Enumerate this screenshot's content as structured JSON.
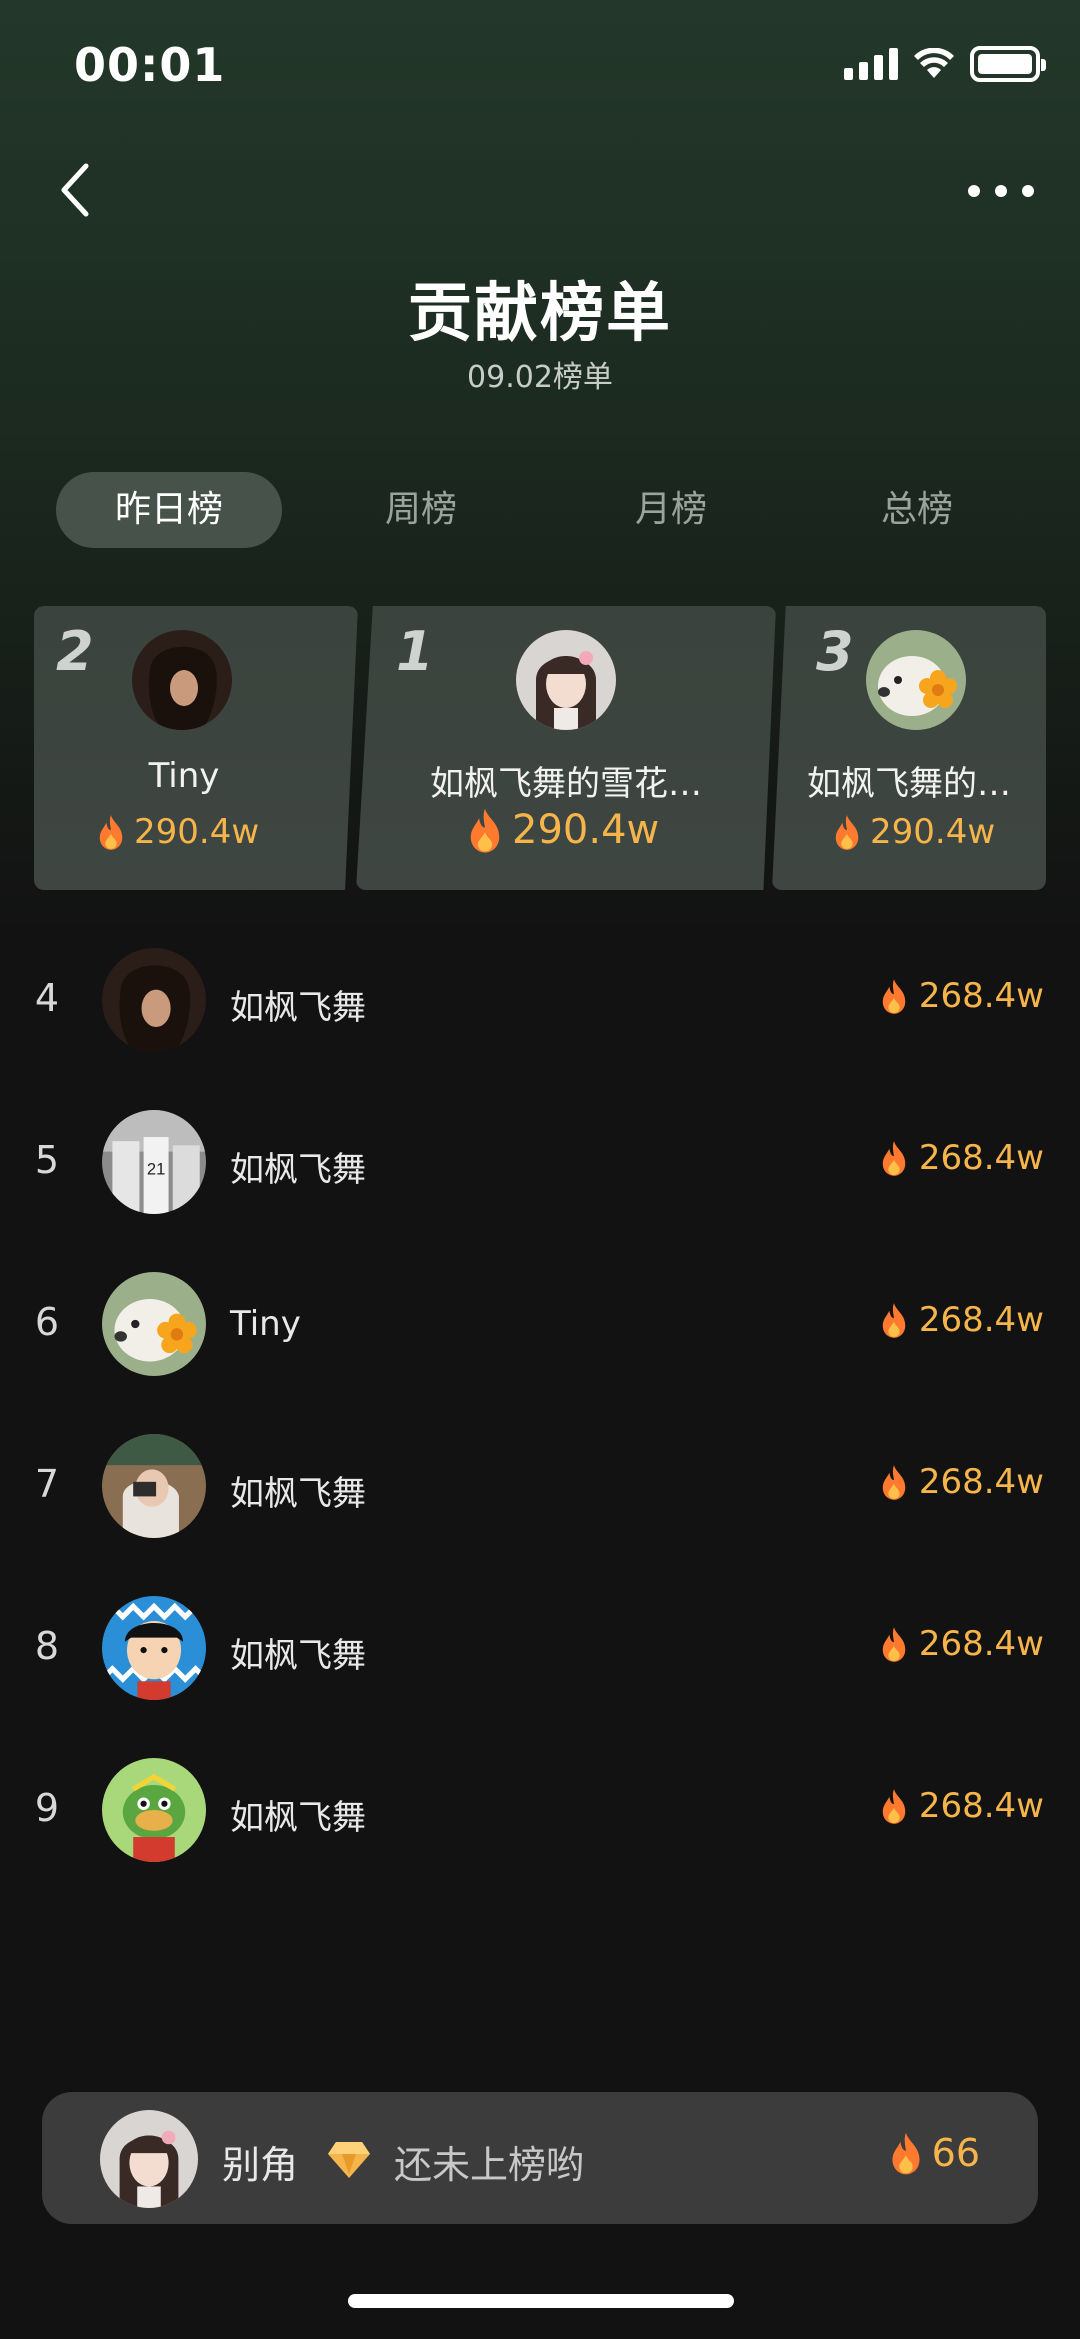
{
  "status_bar": {
    "time": "00:01"
  },
  "header": {
    "title": "贡献榜单",
    "subtitle": "09.02榜单"
  },
  "tabs": [
    {
      "label": "昨日榜",
      "active": true
    },
    {
      "label": "周榜",
      "active": false
    },
    {
      "label": "月榜",
      "active": false
    },
    {
      "label": "总榜",
      "active": false
    }
  ],
  "podium": [
    {
      "rank": "2",
      "name": "Tiny",
      "score": "290.4w",
      "avatar": "woman-dark-hair"
    },
    {
      "rank": "1",
      "name": "如枫飞舞的雪花…",
      "score": "290.4w",
      "avatar": "girl-pink-bow"
    },
    {
      "rank": "3",
      "name": "如枫飞舞的…",
      "score": "290.4w",
      "avatar": "dog-with-flower"
    }
  ],
  "ranking": [
    {
      "rank": "4",
      "name": "如枫飞舞",
      "score": "268.4w",
      "avatar": "woman-dark-hair"
    },
    {
      "rank": "5",
      "name": "如枫飞舞",
      "score": "268.4w",
      "avatar": "basketball-players"
    },
    {
      "rank": "6",
      "name": "Tiny",
      "score": "268.4w",
      "avatar": "dog-with-flower"
    },
    {
      "rank": "7",
      "name": "如枫飞舞",
      "score": "268.4w",
      "avatar": "girl-camera"
    },
    {
      "rank": "8",
      "name": "如枫飞舞",
      "score": "268.4w",
      "avatar": "cartoon-boy"
    },
    {
      "rank": "9",
      "name": "如枫飞舞",
      "score": "268.4w",
      "avatar": "cartoon-character"
    }
  ],
  "my_rank": {
    "name": "别角",
    "status": "还未上榜哟",
    "score": "66",
    "avatar": "girl-pink-bow"
  },
  "colors": {
    "accent_gold": "#f6b54a",
    "flame_orange": "#ff7a2e",
    "tab_active_bg": "#46524a",
    "card_bg": "#3d4540"
  }
}
